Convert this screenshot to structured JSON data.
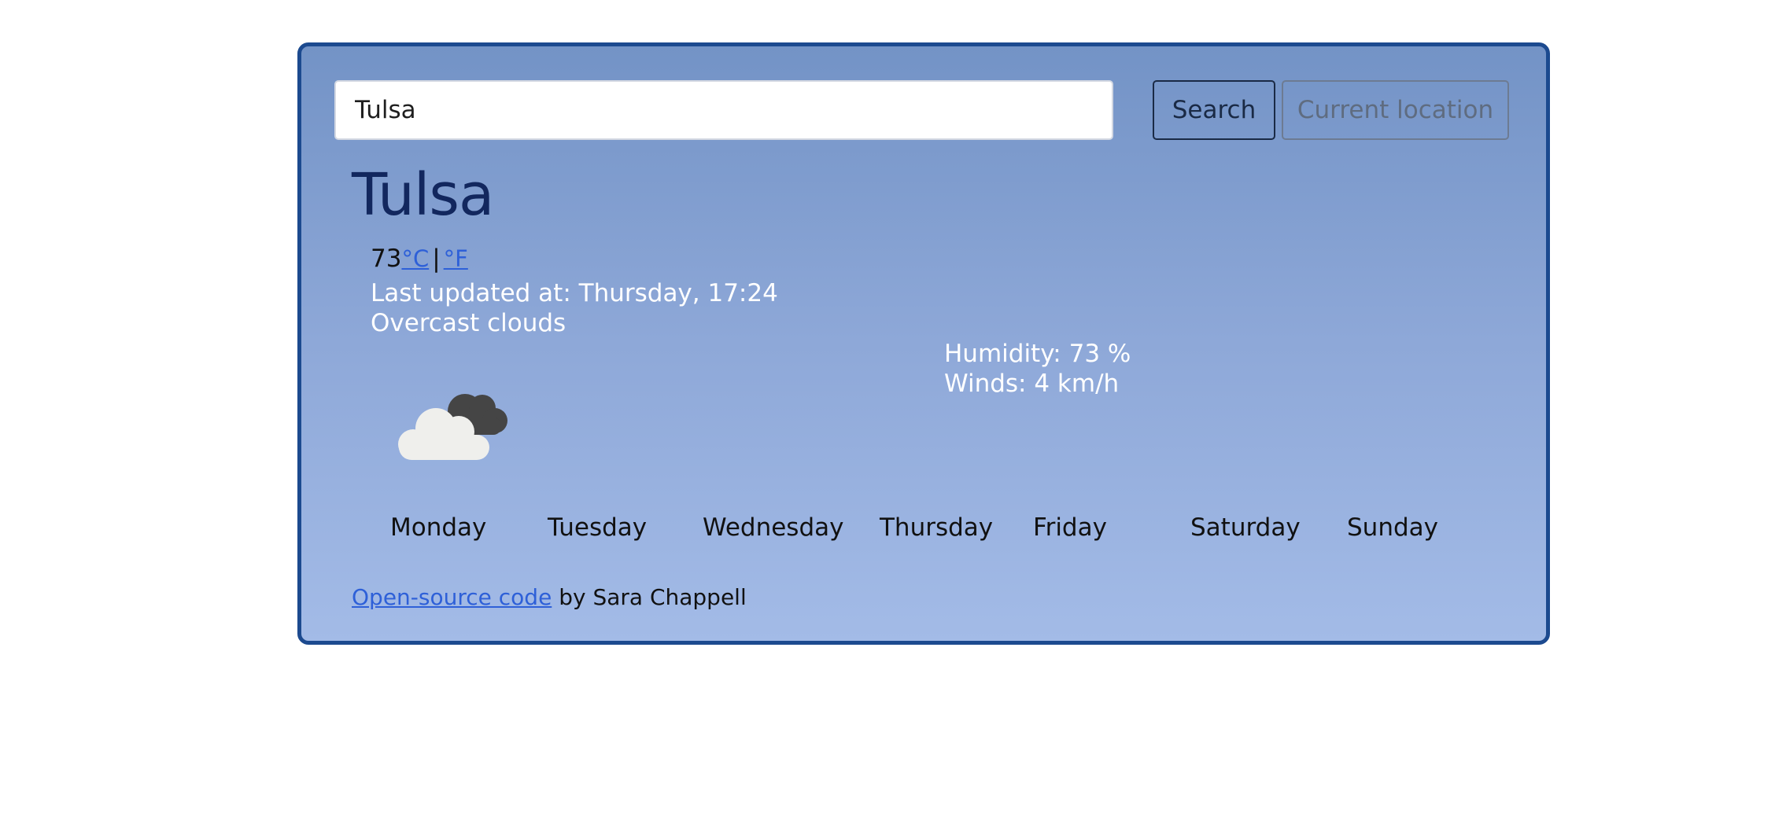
{
  "search": {
    "value": "Tulsa",
    "button_label": "Search",
    "location_button_label": "Current location"
  },
  "weather": {
    "city": "Tulsa",
    "temperature": "73",
    "unit_celsius": "°C",
    "unit_separator": "|",
    "unit_fahrenheit": "°F",
    "last_updated": "Last updated at: Thursday, 17:24",
    "description": "Overcast clouds",
    "icon": "overcast-clouds-icon",
    "humidity": "Humidity: 73 %",
    "winds": "Winds: 4 km/h"
  },
  "forecast": {
    "days": [
      "Monday",
      "Tuesday",
      "Wednesday",
      "Thursday",
      "Friday",
      "Saturday",
      "Sunday"
    ]
  },
  "footer": {
    "link_text": "Open-source code",
    "author_text": " by Sara Chappell"
  },
  "colors": {
    "card_border": "#1c4a8f",
    "card_gradient_top": "#7393c6",
    "card_gradient_bottom": "#a3bbe7",
    "title": "#12275e",
    "link": "#2e60d8"
  }
}
